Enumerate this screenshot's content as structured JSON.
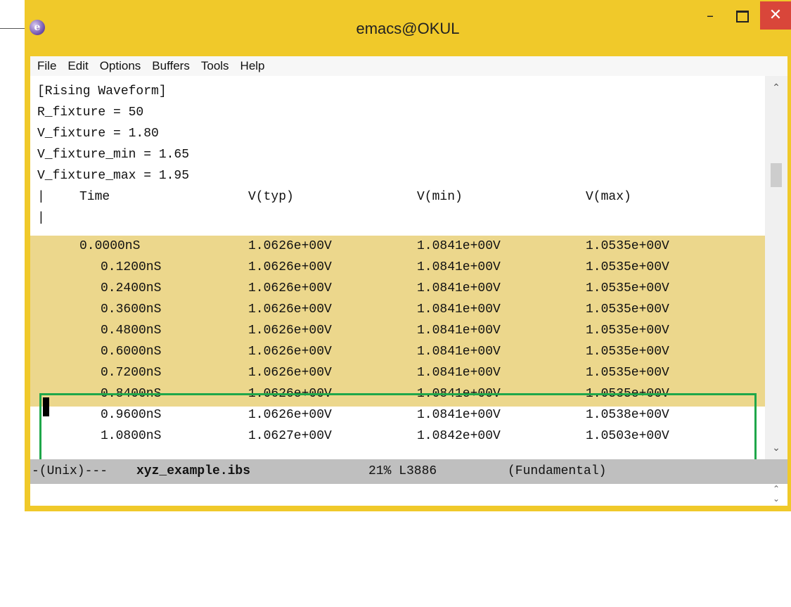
{
  "window": {
    "title": "emacs@OKUL",
    "app_icon": "emacs-icon",
    "controls": {
      "minimize": "–",
      "close": "✕"
    }
  },
  "menubar": [
    "File",
    "Edit",
    "Options",
    "Buffers",
    "Tools",
    "Help"
  ],
  "buffer": {
    "header_lines": [
      "[Rising Waveform]",
      "R_fixture = 50",
      "V_fixture = 1.80",
      "V_fixture_min = 1.65",
      "V_fixture_max = 1.95"
    ],
    "column_comment_prefix": "|",
    "columns": [
      "Time",
      "V(typ)",
      "V(min)",
      "V(max)"
    ],
    "empty_comment": "|",
    "rows": [
      [
        "0.0000nS",
        "1.0626e+00V",
        "1.0841e+00V",
        "1.0535e+00V"
      ],
      [
        "0.1200nS",
        "1.0626e+00V",
        "1.0841e+00V",
        "1.0535e+00V"
      ],
      [
        "0.2400nS",
        "1.0626e+00V",
        "1.0841e+00V",
        "1.0535e+00V"
      ],
      [
        "0.3600nS",
        "1.0626e+00V",
        "1.0841e+00V",
        "1.0535e+00V"
      ],
      [
        "0.4800nS",
        "1.0626e+00V",
        "1.0841e+00V",
        "1.0535e+00V"
      ],
      [
        "0.6000nS",
        "1.0626e+00V",
        "1.0841e+00V",
        "1.0535e+00V"
      ],
      [
        "0.7200nS",
        "1.0626e+00V",
        "1.0841e+00V",
        "1.0535e+00V"
      ],
      [
        "0.8400nS",
        "1.0626e+00V",
        "1.0841e+00V",
        "1.0535e+00V"
      ],
      [
        "0.9600nS",
        "1.0626e+00V",
        "1.0841e+00V",
        "1.0538e+00V"
      ],
      [
        "1.0800nS",
        "1.0627e+00V",
        "1.0842e+00V",
        "1.0503e+00V"
      ]
    ],
    "highlighted_rows": 7,
    "boxed_rows": 3
  },
  "modeline": {
    "prefix": "-(Unix)---",
    "filename": "xyz_example.ibs",
    "position": "21% L3886",
    "mode": "(Fundamental)"
  },
  "colors": {
    "titlebar": "#f0c92a",
    "region_highlight": "#ecd78c",
    "box_outline": "#1fa74a",
    "close_button": "#d9463a",
    "modeline": "#bfbfbf"
  }
}
